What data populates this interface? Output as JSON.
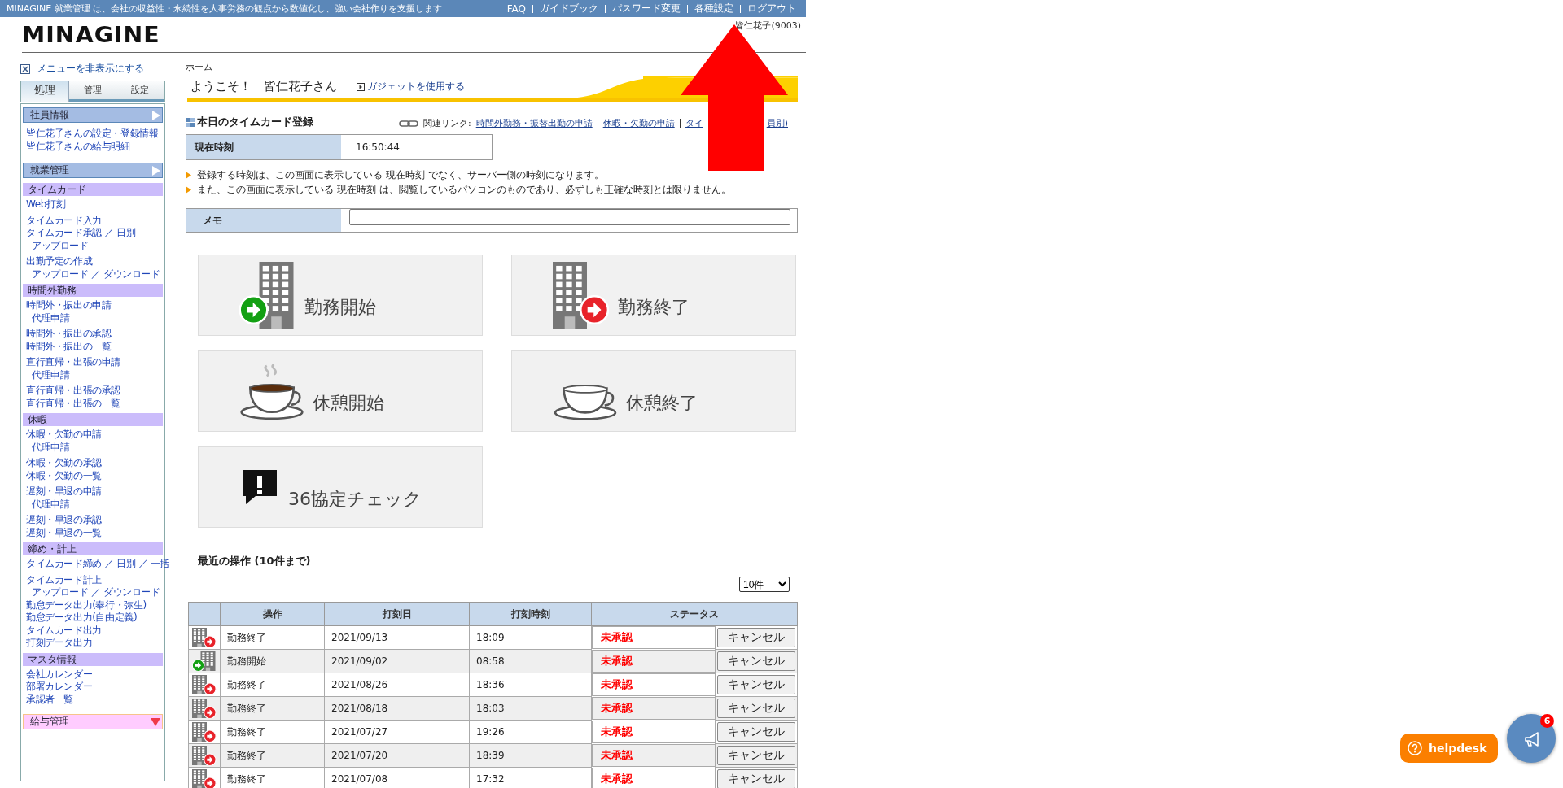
{
  "top_bar": {
    "tagline": "MINAGINE 就業管理 は、会社の収益性・永続性を人事労務の観点から数値化し、強い会社作りを支援します",
    "links": [
      "FAQ",
      "ガイドブック",
      "パスワード変更",
      "各種設定",
      "ログアウト"
    ]
  },
  "logo": "MINAGINE",
  "user": "皆仁花子(9003)",
  "sidebar": {
    "hide_menu": "メニューを非表示にする",
    "tabs": [
      {
        "label": "処理",
        "selected": true
      },
      {
        "label": "管理",
        "selected": false
      },
      {
        "label": "設定",
        "selected": false
      }
    ],
    "blocks": [
      {
        "kind": "header",
        "label": "社員情報",
        "expanded": true,
        "groups": [
          [
            {
              "label": "皆仁花子さんの設定・登録情報",
              "kind": "link"
            },
            {
              "label": "皆仁花子さんの給与明細",
              "kind": "link"
            }
          ]
        ]
      },
      {
        "kind": "header",
        "label": "就業管理",
        "expanded": true
      },
      {
        "kind": "category",
        "label": "タイムカード",
        "groups": [
          [
            {
              "label": "Web打刻",
              "kind": "link"
            }
          ],
          [
            {
              "label": "タイムカード入力",
              "kind": "link"
            },
            {
              "label": "タイムカード承認 ／ 日別",
              "kind": "link"
            },
            {
              "label": "アップロード",
              "kind": "sublink"
            }
          ],
          [
            {
              "label": "出勤予定の作成",
              "kind": "link"
            },
            {
              "label": "アップロード ／ ダウンロード",
              "kind": "sublink"
            }
          ]
        ]
      },
      {
        "kind": "category",
        "label": "時間外勤務",
        "groups": [
          [
            {
              "label": "時間外・振出の申請",
              "kind": "link"
            },
            {
              "label": "代理申請",
              "kind": "sublink"
            }
          ],
          [
            {
              "label": "時間外・振出の承認",
              "kind": "link"
            },
            {
              "label": "時間外・振出の一覧",
              "kind": "link"
            }
          ],
          [
            {
              "label": "直行直帰・出張の申請",
              "kind": "link"
            },
            {
              "label": "代理申請",
              "kind": "sublink"
            }
          ],
          [
            {
              "label": "直行直帰・出張の承認",
              "kind": "link"
            },
            {
              "label": "直行直帰・出張の一覧",
              "kind": "link"
            }
          ]
        ]
      },
      {
        "kind": "category",
        "label": "休暇",
        "groups": [
          [
            {
              "label": "休暇・欠勤の申請",
              "kind": "link"
            },
            {
              "label": "代理申請",
              "kind": "sublink"
            }
          ],
          [
            {
              "label": "休暇・欠勤の承認",
              "kind": "link"
            },
            {
              "label": "休暇・欠勤の一覧",
              "kind": "link"
            }
          ],
          [
            {
              "label": "遅刻・早退の申請",
              "kind": "link"
            },
            {
              "label": "代理申請",
              "kind": "sublink"
            }
          ],
          [
            {
              "label": "遅刻・早退の承認",
              "kind": "link"
            },
            {
              "label": "遅刻・早退の一覧",
              "kind": "link"
            }
          ]
        ]
      },
      {
        "kind": "category",
        "label": "締め・計上",
        "groups": [
          [
            {
              "label": "タイムカード締め ／ 日別 ／ 一括",
              "kind": "link"
            }
          ],
          [
            {
              "label": "タイムカード計上",
              "kind": "link"
            },
            {
              "label": "アップロード ／ ダウンロード",
              "kind": "sublink"
            },
            {
              "label": "勤怠データ出力(奉行・弥生)",
              "kind": "link"
            },
            {
              "label": "勤怠データ出力(自由定義)",
              "kind": "link"
            },
            {
              "label": "タイムカード出力",
              "kind": "link"
            },
            {
              "label": "打刻データ出力",
              "kind": "link"
            }
          ]
        ]
      },
      {
        "kind": "category",
        "label": "マスタ情報",
        "groups": [
          [
            {
              "label": "会社カレンダー",
              "kind": "link"
            },
            {
              "label": "部署カレンダー",
              "kind": "link"
            },
            {
              "label": "承認者一覧",
              "kind": "link"
            }
          ]
        ]
      },
      {
        "kind": "header",
        "label": "給与管理",
        "expanded": false
      }
    ]
  },
  "main": {
    "breadcrumb": "ホーム",
    "welcome": "ようこそ！　皆仁花子さん",
    "gadget_link": "ガジェットを使用する",
    "section_title": "本日のタイムカード登録",
    "related": {
      "label": "関連リンク:",
      "links": [
        "時間外勤務・振替出勤の申請",
        "休暇・欠勤の申請",
        "タイ"
      ],
      "trailing": "員別)"
    },
    "clock": {
      "label": "現在時刻",
      "value": "16:50:44"
    },
    "notes": [
      "登録する時刻は、この画面に表示している 現在時刻 でなく、サーバー側の時刻になります。",
      "また、この画面に表示している 現在時刻 は、閲覧しているパソコンのものであり、必ずしも正確な時刻とは限りません。"
    ],
    "memo": {
      "label": "メモ"
    },
    "punch_buttons": [
      {
        "kind": "work-start",
        "label": "勤務開始"
      },
      {
        "kind": "work-end",
        "label": "勤務終了"
      },
      {
        "kind": "break-start",
        "label": "休憩開始"
      },
      {
        "kind": "break-end",
        "label": "休憩終了"
      },
      {
        "kind": "check",
        "label": "36協定チェック"
      }
    ],
    "recent": {
      "title": "最近の操作 (10件まで)",
      "page_size": "10件",
      "columns": [
        "操作",
        "打刻日",
        "打刻時刻",
        "ステータス"
      ],
      "rows": [
        {
          "kind": "work-end",
          "action": "勤務終了",
          "date": "2021/09/13",
          "time": "18:09",
          "status": "未承認",
          "button": "キャンセル"
        },
        {
          "kind": "work-start",
          "action": "勤務開始",
          "date": "2021/09/02",
          "time": "08:58",
          "status": "未承認",
          "button": "キャンセル"
        },
        {
          "kind": "work-end",
          "action": "勤務終了",
          "date": "2021/08/26",
          "time": "18:36",
          "status": "未承認",
          "button": "キャンセル"
        },
        {
          "kind": "work-end",
          "action": "勤務終了",
          "date": "2021/08/18",
          "time": "18:03",
          "status": "未承認",
          "button": "キャンセル"
        },
        {
          "kind": "work-end",
          "action": "勤務終了",
          "date": "2021/07/27",
          "time": "19:26",
          "status": "未承認",
          "button": "キャンセル"
        },
        {
          "kind": "work-end",
          "action": "勤務終了",
          "date": "2021/07/20",
          "time": "18:39",
          "status": "未承認",
          "button": "キャンセル"
        },
        {
          "kind": "work-end",
          "action": "勤務終了",
          "date": "2021/07/08",
          "time": "17:32",
          "status": "未承認",
          "button": "キャンセル"
        }
      ]
    }
  },
  "helpdesk": {
    "label": "helpdesk",
    "badge": "6"
  }
}
